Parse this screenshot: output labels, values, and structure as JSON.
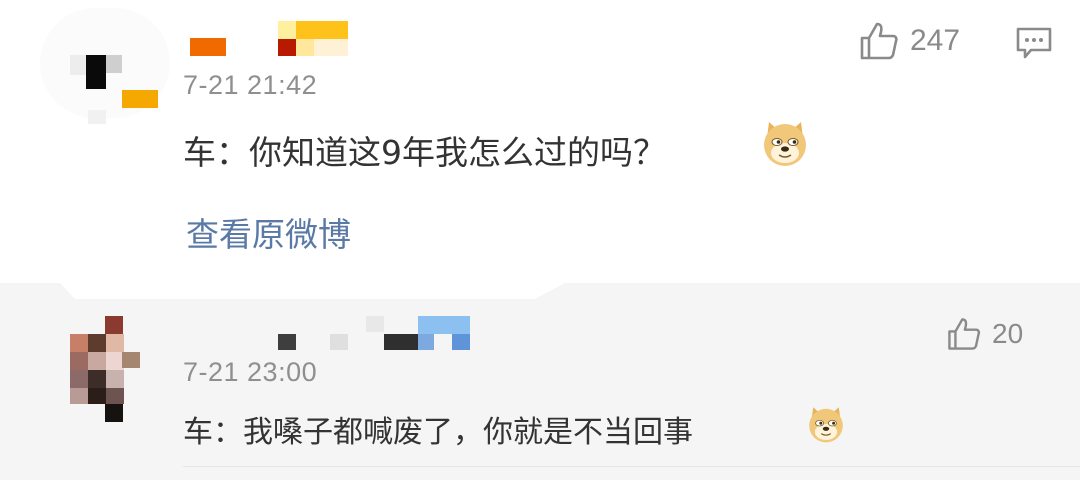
{
  "comments": [
    {
      "time": "7-21 21:42",
      "text": "车：你知道这9年我怎么过的吗？",
      "emoji": "doge-icon",
      "like_count": "247",
      "link": "查看原微博"
    },
    {
      "time": "7-21 23:00",
      "text": "车：我嗓子都喊废了，你就是不当回事",
      "emoji": "doge-icon",
      "like_count": "20"
    }
  ],
  "colors": {
    "link": "#5a79a6",
    "text": "#333333",
    "meta": "#8f8f8f",
    "reply_bg": "#f5f5f5"
  }
}
